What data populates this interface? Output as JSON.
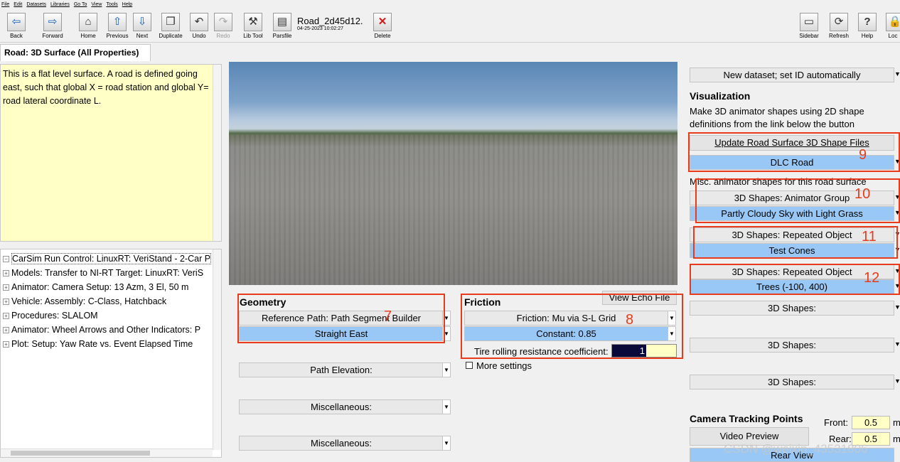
{
  "menu": [
    "File",
    "Edit",
    "Datasets",
    "Libraries",
    "Go To",
    "View",
    "Tools",
    "Help"
  ],
  "toolbar": {
    "back": "Back",
    "forward": "Forward",
    "home": "Home",
    "previous": "Previous",
    "next": "Next",
    "duplicate": "Duplicate",
    "undo": "Undo",
    "redo": "Redo",
    "libtool": "Lib Tool",
    "parsfile": "Parsfile",
    "delete": "Delete",
    "sidebar": "Sidebar",
    "refresh": "Refresh",
    "help": "Help",
    "lock": "Loc"
  },
  "dataset": {
    "title": "Road_2d45d12.",
    "date": "04-25-2023 10:02:27"
  },
  "tab": "Road: 3D Surface (All Properties)",
  "notes": "This is a flat level surface. A road is defined going east, such that global X = road station and global Y= road lateral coordinate L.",
  "tree": [
    "CarSim Run Control: LinuxRT: VeriStand - 2-Car P",
    "Models: Transfer to NI-RT Target: LinuxRT: VeriS",
    "Animator: Camera Setup: 13 Azm, 3 El, 50 m",
    "Vehicle: Assembly: C-Class, Hatchback",
    "Procedures: SLALOM",
    "Animator: Wheel Arrows and Other Indicators: P",
    "Plot: Setup: Yaw Rate vs. Event Elapsed Time"
  ],
  "geometry": {
    "heading": "Geometry",
    "ref_path": "Reference Path: Path Segment Builder",
    "ref_value": "Straight East",
    "elevation": "Path Elevation:",
    "misc1": "Miscellaneous:",
    "misc2": "Miscellaneous:"
  },
  "friction": {
    "view_echo": "View Echo File",
    "heading": "Friction",
    "mode": "Friction: Mu via S-L Grid",
    "value": "Constant: 0.85",
    "rolling_label": "Tire rolling resistance coefficient:",
    "rolling_value": "1",
    "more": "More settings"
  },
  "right": {
    "new_dataset": "New dataset; set ID automatically",
    "viz_heading": "Visualization",
    "viz_desc": "Make 3D animator shapes using 2D shape definitions from the link below the button",
    "update_btn": "Update Road Surface 3D Shape Files",
    "dlc": "DLC Road",
    "misc_label": "Misc. animator shapes for this road surface",
    "animator_group": "3D Shapes: Animator Group",
    "sky": "Partly Cloudy Sky with Light Grass",
    "rep1": "3D Shapes: Repeated Object",
    "cones": "Test Cones",
    "rep2": "3D Shapes: Repeated Object",
    "trees": "Trees (-100, 400)",
    "shapes1": "3D Shapes:",
    "shapes2": "3D Shapes:",
    "shapes3": "3D Shapes:",
    "cam_heading": "Camera Tracking Points",
    "front_label": "Front:",
    "front_value": "0.5",
    "front_unit": "m",
    "rear_label": "Rear:",
    "rear_value": "0.5",
    "rear_unit": "m",
    "video": "Video Preview",
    "rear_view": "Rear View"
  },
  "annotations": [
    "7",
    "8",
    "9",
    "10",
    "11",
    "12"
  ],
  "watermark": "CSDN @weixin_43531806",
  "colors": {
    "highlight": "#e83b1c",
    "selected": "#99c8f6",
    "notes_bg": "#ffffc6"
  }
}
